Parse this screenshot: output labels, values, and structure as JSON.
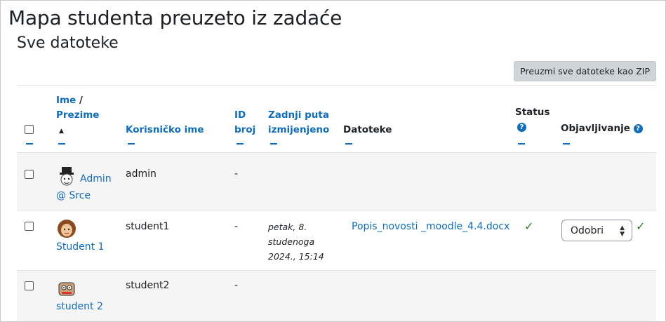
{
  "page": {
    "title": "Mapa studenta preuzeto iz zadaće",
    "subtitle": "Sve datoteke",
    "download_button": "Preuzmi sve datoteke kao ZIP"
  },
  "table": {
    "headers": {
      "name_first": "Ime",
      "name_sep": " /",
      "name_last": "Prezime",
      "sort_indicator": "▲",
      "username": "Korisničko ime",
      "id_line1": "ID",
      "id_line2": "broj",
      "modified_line1": "Zadnji puta",
      "modified_line2": "izmijenjeno",
      "files": "Datoteke",
      "status": "Status",
      "publishing": "Objavljivanje",
      "help": "?"
    },
    "rows": [
      {
        "name_line1": "Admin",
        "name_line2": "@ Srce",
        "username": "admin",
        "id": "-",
        "modified": "",
        "file": "",
        "status": "",
        "publish": ""
      },
      {
        "name": "Student 1",
        "username": "student1",
        "id": "-",
        "modified_l1": "petak, 8.",
        "modified_l2": "studenoga",
        "modified_l3": "2024., 15:14",
        "file": "Popis_novosti _moodle_4.4.docx",
        "status": "✓",
        "publish": "Odobri",
        "publish_check": "✓"
      },
      {
        "name": "student 2",
        "username": "student2",
        "id": "-",
        "modified": "",
        "file": "",
        "status": "",
        "publish": ""
      }
    ]
  },
  "colors": {
    "link": "#0f6cbf",
    "check": "#357a32",
    "button_bg": "#ced4da"
  }
}
